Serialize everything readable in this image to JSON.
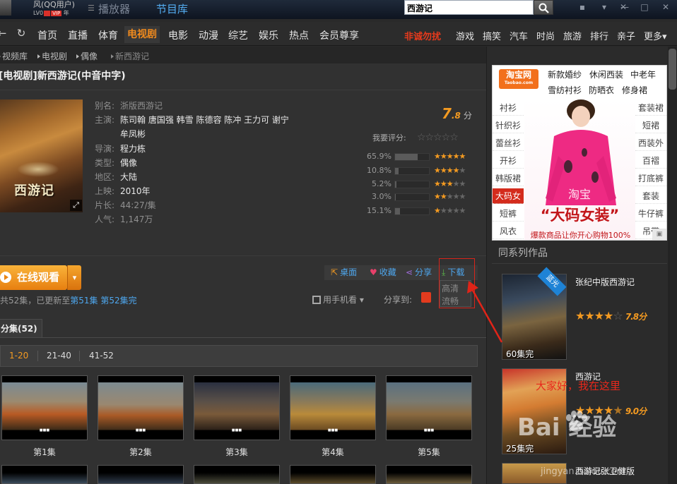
{
  "titlebar": {
    "username": "风(QQ用户)",
    "level": "LV0",
    "vip": "VIP",
    "year": "年",
    "tabs": [
      "播放器",
      "节目库"
    ],
    "search_value": "西游记"
  },
  "nav": {
    "items": [
      "首页",
      "直播",
      "体育",
      "电视剧",
      "电影",
      "动漫",
      "综艺",
      "娱乐",
      "热点",
      "会员尊享"
    ],
    "promo": "非诚勿扰",
    "small_items": [
      "游戏",
      "搞笑",
      "汽车",
      "时尚",
      "旅游",
      "排行",
      "亲子",
      "更多"
    ],
    "active": "电视剧"
  },
  "breadcrumb": [
    "视频库",
    "电视剧",
    "偶像",
    "新西游记"
  ],
  "show": {
    "title": "[电视剧]新西游记(中音中字)",
    "meta": [
      {
        "label": "别名:",
        "value": "浙版西游记",
        "dim": true
      },
      {
        "label": "主演:",
        "value": "陈司翰 唐国强 韩雪 陈德容 陈冲 王力可 谢宁"
      },
      {
        "label": "",
        "value": "牟凤彬"
      },
      {
        "label": "导演:",
        "value": "程力栋"
      },
      {
        "label": "类型:",
        "value": "偶像"
      },
      {
        "label": "地区:",
        "value": "大陆"
      },
      {
        "label": "上映:",
        "value": "2010年"
      },
      {
        "label": "片长:",
        "value": "44:27/集",
        "dim": true
      },
      {
        "label": "人气:",
        "value": "1,147万",
        "dim": true
      }
    ],
    "poster_title": "西游记",
    "rating_int": "7",
    "rating_dec": ".8",
    "rating_unit": "分",
    "my_rating_label": "我要评分:",
    "rating_distribution": [
      {
        "pct": "65.9%",
        "stars": 5,
        "fraction": 0.659
      },
      {
        "pct": "10.8%",
        "stars": 4,
        "fraction": 0.108
      },
      {
        "pct": "5.2%",
        "stars": 3,
        "fraction": 0.052
      },
      {
        "pct": "3.0%",
        "stars": 2,
        "fraction": 0.03
      },
      {
        "pct": "15.1%",
        "stars": 1,
        "fraction": 0.151
      }
    ]
  },
  "actions": {
    "watch": "在线观看",
    "desktop": "桌面",
    "favorite": "收藏",
    "share": "分享",
    "download": "下载",
    "dl_options": [
      "高清",
      "流畅"
    ],
    "mobile": "用手机看",
    "share_to": "分享到:"
  },
  "episodes_note": {
    "text": "共52集，已更新至",
    "link1": "第51集",
    "link2": "第52集完"
  },
  "episodes": {
    "tab": "分集(52)",
    "ranges": [
      "1-20",
      "21-40",
      "41-52"
    ],
    "items": [
      "第1集",
      "第2集",
      "第3集",
      "第4集",
      "第5集"
    ]
  },
  "ad": {
    "brand": "淘宝网",
    "brand_sub": "Taobao.com",
    "links": [
      "新款婚纱",
      "休闲西装",
      "中老年",
      "雪纺衬衫",
      "防晒衣",
      "修身裙"
    ],
    "left_cats": [
      "衬衫",
      "针织衫",
      "蕾丝衫",
      "开衫",
      "韩版裙",
      "大码女",
      "短裤",
      "风衣"
    ],
    "right_cats": [
      "套装裙",
      "短裙",
      "西装外",
      "百褶",
      "打底裤",
      "套装",
      "牛仔裤",
      "吊带"
    ],
    "highlight": "大码女",
    "slogan": "“大码女装”",
    "sub": "爆款商品让你开心购物100%",
    "model_text": "淘宝"
  },
  "series": {
    "title": "同系列作品",
    "items": [
      {
        "name": "张纪中版西游记",
        "score": "7.8分",
        "stars": 4,
        "eps": "60集完",
        "badge": "蓝光"
      },
      {
        "name": "西游记",
        "score": "9.0分",
        "stars": 4.5,
        "eps": "25集完"
      },
      {
        "name": "西游记张卫健版"
      }
    ]
  },
  "annotation": "大家好，我在这里",
  "watermark": {
    "brand": "Bai 经验",
    "url": "jingyan.baidu.com"
  },
  "colors": {
    "accent": "#f39a21",
    "link": "#4ea7ee",
    "highlight": "#d9241a"
  }
}
